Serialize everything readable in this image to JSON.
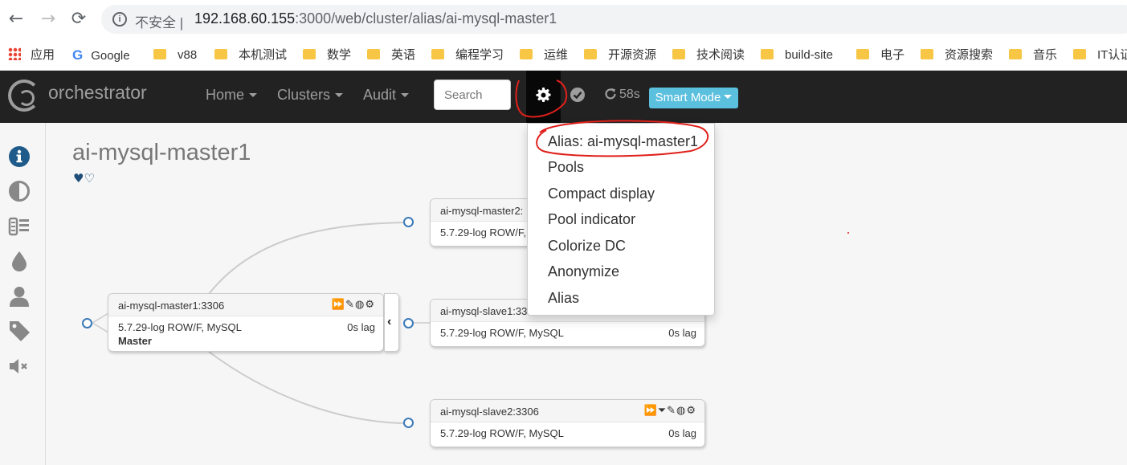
{
  "browser": {
    "back": "←",
    "forward": "→",
    "reload": "⟳",
    "insecure_label": "不安全 |",
    "url_host": "192.168.60.155",
    "url_path": ":3000/web/cluster/alias/ai-mysql-master1"
  },
  "bookmarks": [
    {
      "label": "应用",
      "kind": "apps"
    },
    {
      "label": "Google",
      "kind": "google"
    },
    {
      "label": "v88",
      "kind": "folder"
    },
    {
      "label": "本机测试",
      "kind": "folder"
    },
    {
      "label": "数学",
      "kind": "folder"
    },
    {
      "label": "英语",
      "kind": "folder"
    },
    {
      "label": "编程学习",
      "kind": "folder"
    },
    {
      "label": "运维",
      "kind": "folder"
    },
    {
      "label": "开源资源",
      "kind": "folder"
    },
    {
      "label": "技术阅读",
      "kind": "folder"
    },
    {
      "label": "build-site",
      "kind": "folder"
    },
    {
      "label": "电子",
      "kind": "folder"
    },
    {
      "label": "资源搜索",
      "kind": "folder"
    },
    {
      "label": "音乐",
      "kind": "folder"
    },
    {
      "label": "IT认证",
      "kind": "folder"
    }
  ],
  "navbar": {
    "brand": "orchestrator",
    "home": "Home",
    "clusters": "Clusters",
    "audit": "Audit",
    "search_placeholder": "Search",
    "refresh_countdown": "58s",
    "smart_mode": "Smart Mode"
  },
  "page": {
    "cluster_title": "ai-mysql-master1",
    "hearts": "♥♡"
  },
  "nodes": {
    "master": {
      "name": "ai-mysql-master1:3306",
      "version": "5.7.29-log ROW/F, MySQL",
      "lag": "0s lag",
      "role": "Master",
      "tools": "⏩✎◍⚙"
    },
    "master2": {
      "name": "ai-mysql-master2:",
      "version": "5.7.29-log ROW/F,"
    },
    "slave1": {
      "name": "ai-mysql-slave1:33",
      "version": "5.7.29-log ROW/F, MySQL",
      "lag": "0s lag"
    },
    "slave2": {
      "name": "ai-mysql-slave2:3306",
      "version": "5.7.29-log ROW/F, MySQL",
      "lag": "0s lag",
      "tools": "⏩⏷✎◍⚙"
    }
  },
  "collapse_glyph": "‹",
  "dropdown": {
    "items": [
      "Alias: ai-mysql-master1",
      "Pools",
      "Compact display",
      "Pool indicator",
      "Colorize DC",
      "Anonymize",
      "Alias"
    ]
  },
  "colors": {
    "navbar_bg": "#222222",
    "accent_info": "#5bc0de",
    "annotation_red": "#e0201b",
    "node_link_blue": "#3a7ab8"
  }
}
